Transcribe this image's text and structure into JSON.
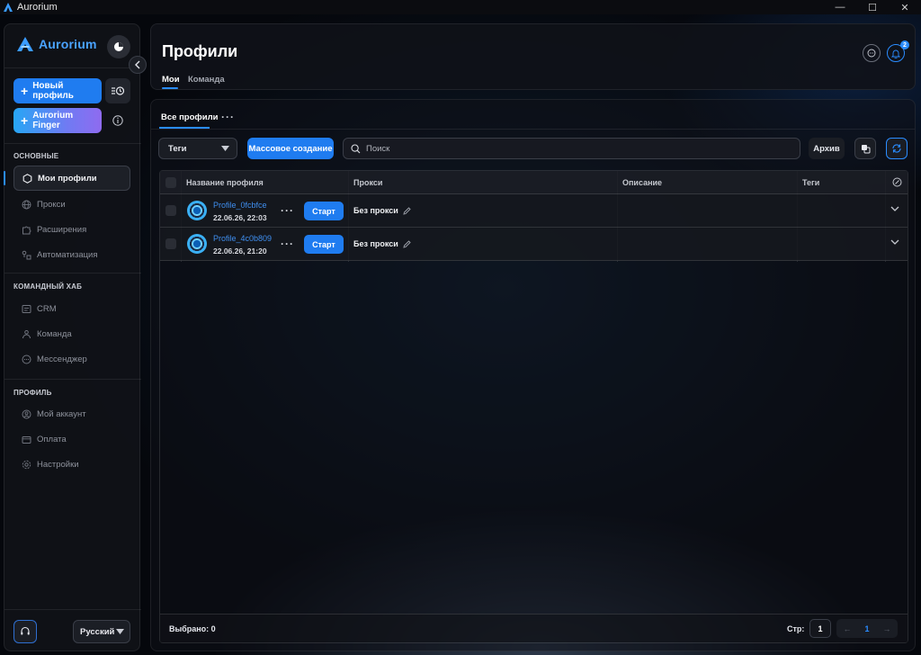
{
  "window": {
    "title": "Aurorium",
    "controls": [
      "—",
      "☐",
      "✕"
    ]
  },
  "sidebar": {
    "brand": "Aurorium",
    "new_profile_label": "Новый профиль",
    "finger_label": "Aurorium Finger",
    "sections": [
      {
        "title": "ОСНОВНЫЕ",
        "items": [
          "Мои профили",
          "Прокси",
          "Расширения",
          "Автоматизация"
        ]
      },
      {
        "title": "КОМАНДНЫЙ ХАБ",
        "items": [
          "CRM",
          "Команда",
          "Мессенджер"
        ]
      },
      {
        "title": "ПРОФИЛЬ",
        "items": [
          "Мой аккаунт",
          "Оплата",
          "Настройки"
        ]
      }
    ],
    "active_item": "Мои профили",
    "language": "Русский"
  },
  "header": {
    "title": "Профили",
    "tabs": [
      "Мои",
      "Команда"
    ],
    "active_tab": "Мои",
    "notification_count": "2"
  },
  "main": {
    "subtab": "Все профили",
    "subtab_more": "···",
    "toolbar": {
      "tags_label": "Теги",
      "mass_create_label": "Массовое создание",
      "search_placeholder": "Поиск",
      "archive_label": "Архив"
    },
    "table": {
      "columns": [
        "Название профиля",
        "Прокси",
        "Описание",
        "Теги"
      ],
      "rows": [
        {
          "name": "Profile_0fcbfce",
          "date": "22.06.26, 22:03",
          "start_label": "Старт",
          "proxy": "Без прокси",
          "description": "",
          "tags": ""
        },
        {
          "name": "Profile_4c0b809",
          "date": "22.06.26, 21:20",
          "start_label": "Старт",
          "proxy": "Без прокси",
          "description": "",
          "tags": ""
        }
      ]
    },
    "footer": {
      "selected": "Выбрано: 0",
      "page_label": "Стр:",
      "page_value": "1",
      "pager": {
        "prev": "←",
        "current": "1",
        "next": "→"
      }
    }
  },
  "colors": {
    "accent": "#2a8cff",
    "button": "#1f7cf0",
    "link": "#3f8ff0"
  }
}
